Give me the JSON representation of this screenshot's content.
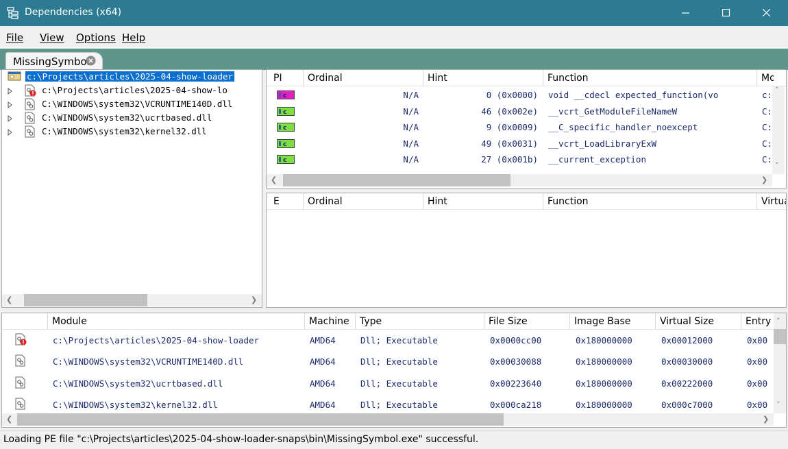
{
  "window": {
    "title": "Dependencies (x64)",
    "controls": [
      "minimize",
      "maximize",
      "close"
    ]
  },
  "menu": {
    "items": [
      {
        "label": "File"
      },
      {
        "label": "View"
      },
      {
        "label": "Options"
      },
      {
        "label": "Help"
      }
    ]
  },
  "tabs": [
    {
      "label": "MissingSymbol",
      "active": true
    }
  ],
  "tree": {
    "items": [
      {
        "label": "c:\\Projects\\articles\\2025-04-show-loader",
        "icon": "exe-icon",
        "selected": true,
        "expander": false
      },
      {
        "label": "c:\\Projects\\articles\\2025-04-show-lo",
        "icon": "dll-error-icon",
        "selected": false,
        "expander": true
      },
      {
        "label": "C:\\WINDOWS\\system32\\VCRUNTIME140D.dll",
        "icon": "dll-icon",
        "selected": false,
        "expander": true
      },
      {
        "label": "C:\\WINDOWS\\system32\\ucrtbased.dll",
        "icon": "dll-icon",
        "selected": false,
        "expander": true
      },
      {
        "label": "C:\\WINDOWS\\system32\\kernel32.dll",
        "icon": "dll-icon",
        "selected": false,
        "expander": true
      }
    ]
  },
  "imports": {
    "headers": {
      "pi": "PI",
      "ordinal": "Ordinal",
      "hint": "Hint",
      "function": "Function",
      "module": "Mo"
    },
    "rows": [
      {
        "icon": "c-function-missing-icon",
        "icon_color": "#e020c0",
        "ordinal": "N/A",
        "hint": "0 (0x0000)",
        "function": "void __cdecl expected_function(vo",
        "module": "c:"
      },
      {
        "icon": "c-function-icon",
        "icon_color": "#7ee040",
        "ordinal": "N/A",
        "hint": "46 (0x002e)",
        "function": "__vcrt_GetModuleFileNameW",
        "module": "C:"
      },
      {
        "icon": "c-function-icon",
        "icon_color": "#7ee040",
        "ordinal": "N/A",
        "hint": "9 (0x0009)",
        "function": "__C_specific_handler_noexcept",
        "module": "C:"
      },
      {
        "icon": "c-function-icon",
        "icon_color": "#7ee040",
        "ordinal": "N/A",
        "hint": "49 (0x0031)",
        "function": "__vcrt_LoadLibraryExW",
        "module": "C:"
      },
      {
        "icon": "c-function-icon",
        "icon_color": "#7ee040",
        "ordinal": "N/A",
        "hint": "27 (0x001b)",
        "function": "__current_exception",
        "module": "C:"
      }
    ]
  },
  "exports": {
    "headers": {
      "e": "E",
      "ordinal": "Ordinal",
      "hint": "Hint",
      "function": "Function",
      "virtual": "Virtua"
    }
  },
  "modules": {
    "headers": {
      "module": "Module",
      "machine": "Machine",
      "type": "Type",
      "file_size": "File Size",
      "image_base": "Image Base",
      "virtual_size": "Virtual Size",
      "entry": "Entry"
    },
    "rows": [
      {
        "icon": "dll-error-icon",
        "module": "c:\\Projects\\articles\\2025-04-show-loader",
        "machine": "AMD64",
        "type": "Dll; Executable",
        "file_size": "0x0000cc00",
        "image_base": "0x180000000",
        "virtual_size": "0x00012000",
        "entry": "0x00"
      },
      {
        "icon": "dll-icon",
        "module": "C:\\WINDOWS\\system32\\VCRUNTIME140D.dll",
        "machine": "AMD64",
        "type": "Dll; Executable",
        "file_size": "0x00030088",
        "image_base": "0x180000000",
        "virtual_size": "0x00030000",
        "entry": "0x00"
      },
      {
        "icon": "dll-icon",
        "module": "C:\\WINDOWS\\system32\\ucrtbased.dll",
        "machine": "AMD64",
        "type": "Dll; Executable",
        "file_size": "0x00223640",
        "image_base": "0x180000000",
        "virtual_size": "0x00222000",
        "entry": "0x00"
      },
      {
        "icon": "dll-icon",
        "module": "C:\\WINDOWS\\system32\\kernel32.dll",
        "machine": "AMD64",
        "type": "Dll; Executable",
        "file_size": "0x000ca218",
        "image_base": "0x180000000",
        "virtual_size": "0x000c7000",
        "entry": "0x00"
      }
    ]
  },
  "status": {
    "text": "Loading PE file \"c:\\Projects\\articles\\2025-04-show-loader-snaps\\bin\\MissingSymbol.exe\" successful."
  }
}
